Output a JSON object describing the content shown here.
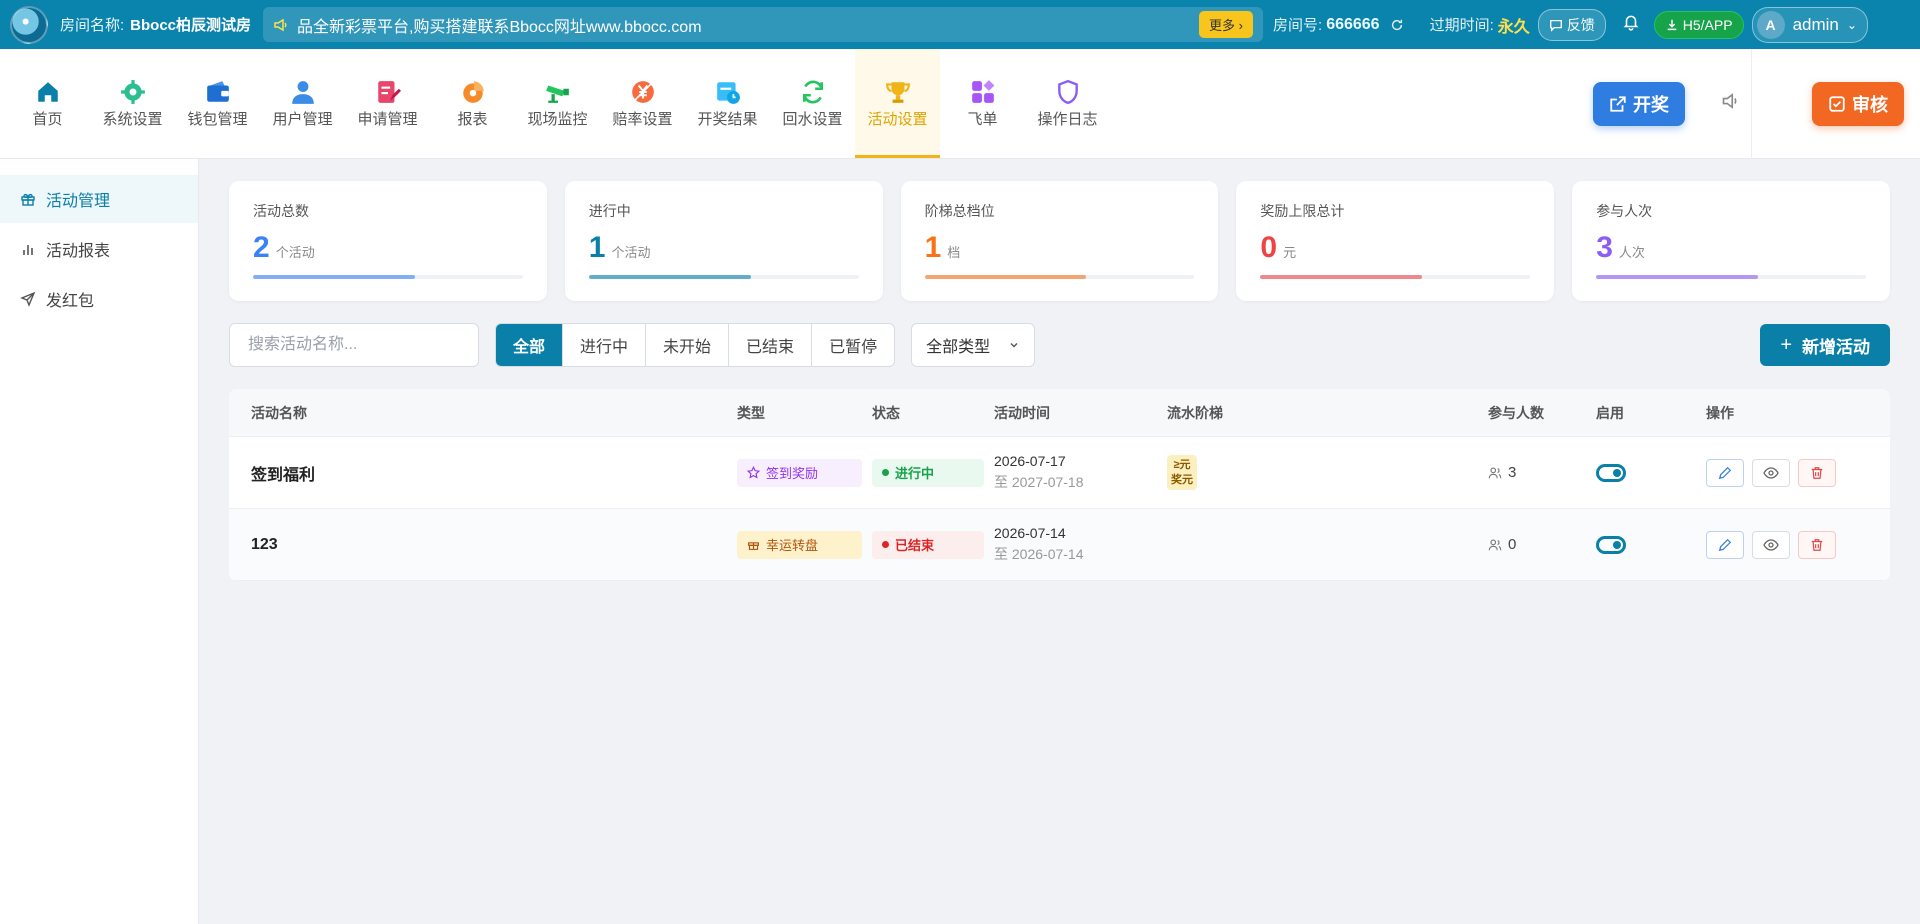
{
  "topbar": {
    "room_label": "房间名称:",
    "room_name": "Bbocc柏辰测试房",
    "notice_text": "品全新彩票平台,购买搭建联系Bbocc网址www.bbocc.com",
    "more_label": "更多",
    "room_no_label": "房间号:",
    "room_no": "666666",
    "expire_label": "过期时间:",
    "expire_value": "永久",
    "feedback_label": "反馈",
    "app_label": "H5/APP",
    "user_initial": "A",
    "user_name": "admin"
  },
  "nav": {
    "items": [
      {
        "label": "首页",
        "icon": "home-icon"
      },
      {
        "label": "系统设置",
        "icon": "gear-icon"
      },
      {
        "label": "钱包管理",
        "icon": "wallet-icon"
      },
      {
        "label": "用户管理",
        "icon": "user-icon"
      },
      {
        "label": "申请管理",
        "icon": "edit-doc-icon"
      },
      {
        "label": "报表",
        "icon": "pie-chart-icon"
      },
      {
        "label": "现场监控",
        "icon": "camera-icon"
      },
      {
        "label": "赔率设置",
        "icon": "yuan-icon"
      },
      {
        "label": "开奖结果",
        "icon": "calendar-clock-icon"
      },
      {
        "label": "回水设置",
        "icon": "refresh-icon"
      },
      {
        "label": "活动设置",
        "icon": "trophy-icon"
      },
      {
        "label": "飞单",
        "icon": "grid-icon"
      },
      {
        "label": "操作日志",
        "icon": "shield-icon"
      }
    ],
    "draw_label": "开奖",
    "audit_label": "审核"
  },
  "sidebar": {
    "items": [
      {
        "label": "活动管理",
        "icon": "gift-icon"
      },
      {
        "label": "活动报表",
        "icon": "bar-chart-icon"
      },
      {
        "label": "发红包",
        "icon": "send-icon"
      }
    ]
  },
  "stats": [
    {
      "title": "活动总数",
      "value": "2",
      "unit": "个活动",
      "color": "#3b82f6",
      "progress": 0.6
    },
    {
      "title": "进行中",
      "value": "1",
      "unit": "个活动",
      "color": "#0a7fa8",
      "progress": 0.6
    },
    {
      "title": "阶梯总档位",
      "value": "1",
      "unit": "档",
      "color": "#f97316",
      "progress": 0.6
    },
    {
      "title": "奖励上限总计",
      "value": "0",
      "unit": "元",
      "color": "#ef4444",
      "progress": 0.6
    },
    {
      "title": "参与人次",
      "value": "3",
      "unit": "人次",
      "color": "#8b5cf6",
      "progress": 0.6
    }
  ],
  "toolbar": {
    "search_placeholder": "搜索活动名称...",
    "filters": [
      "全部",
      "进行中",
      "未开始",
      "已结束",
      "已暂停"
    ],
    "type_select": "全部类型",
    "add_label": "新增活动"
  },
  "table": {
    "headers": [
      "活动名称",
      "类型",
      "状态",
      "活动时间",
      "流水阶梯",
      "参与人数",
      "启用",
      "操作"
    ],
    "rows": [
      {
        "name": "签到福利",
        "type": "签到奖励",
        "status": "进行中",
        "start": "2026-07-17",
        "end": "至 2027-07-18",
        "ladder_line1": "≥元",
        "ladder_line2": "奖元",
        "people": "3"
      },
      {
        "name": "123",
        "type": "幸运转盘",
        "status": "已结束",
        "start": "2026-07-14",
        "end": "至 2026-07-14",
        "ladder_line1": "",
        "ladder_line2": "",
        "people": "0"
      }
    ]
  }
}
